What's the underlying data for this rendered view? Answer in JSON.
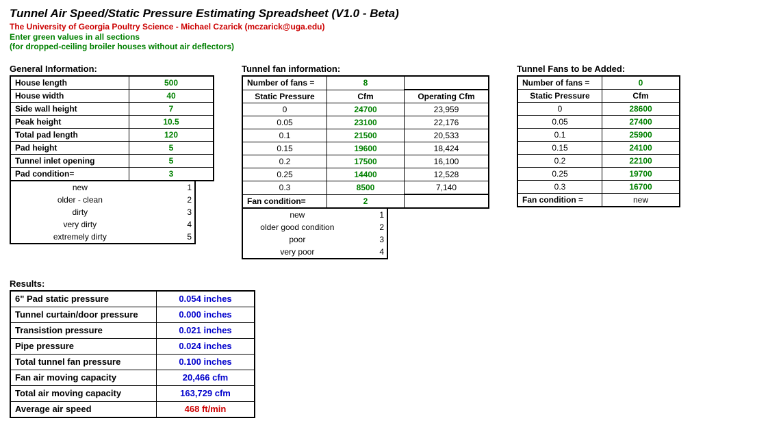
{
  "header": {
    "title": "Tunnel Air Speed/Static Pressure Estimating Spreadsheet  (V1.0 - Beta)",
    "sub_red": "The University of Georgia Poultry Science - Michael Czarick  (mczarick@uga.edu)",
    "sub_green1": "Enter green values in all sections",
    "sub_green2": "(for dropped-ceiling broiler houses without air deflectors)"
  },
  "general": {
    "heading": "General Information:",
    "rows": [
      {
        "label": "House length",
        "value": "500"
      },
      {
        "label": "House width",
        "value": "40"
      },
      {
        "label": "Side wall height",
        "value": "7"
      },
      {
        "label": "Peak height",
        "value": "10.5"
      },
      {
        "label": "Total pad length",
        "value": "120"
      },
      {
        "label": "Pad height",
        "value": "5"
      },
      {
        "label": "Tunnel inlet opening",
        "value": "5"
      },
      {
        "label": "Pad condition=",
        "value": "3"
      }
    ],
    "cond": [
      {
        "label": "new",
        "num": "1"
      },
      {
        "label": "older - clean",
        "num": "2"
      },
      {
        "label": "dirty",
        "num": "3"
      },
      {
        "label": "very dirty",
        "num": "4"
      },
      {
        "label": "extremely dirty",
        "num": "5"
      }
    ]
  },
  "fan": {
    "heading": "Tunnel fan information:",
    "num_label": "Number of fans =",
    "num_value": "8",
    "hdr_sp": "Static Pressure",
    "hdr_cfm": "Cfm",
    "hdr_op": "Operating Cfm",
    "rows": [
      {
        "sp": "0",
        "cfm": "24700",
        "op": "23,959"
      },
      {
        "sp": "0.05",
        "cfm": "23100",
        "op": "22,176"
      },
      {
        "sp": "0.1",
        "cfm": "21500",
        "op": "20,533"
      },
      {
        "sp": "0.15",
        "cfm": "19600",
        "op": "18,424"
      },
      {
        "sp": "0.2",
        "cfm": "17500",
        "op": "16,100"
      },
      {
        "sp": "0.25",
        "cfm": "14400",
        "op": "12,528"
      },
      {
        "sp": "0.3",
        "cfm": "8500",
        "op": "7,140"
      }
    ],
    "cond_label": "Fan condition=",
    "cond_value": "2",
    "cond": [
      {
        "label": "new",
        "num": "1"
      },
      {
        "label": "older good condition",
        "num": "2"
      },
      {
        "label": "poor",
        "num": "3"
      },
      {
        "label": "very poor",
        "num": "4"
      }
    ]
  },
  "add": {
    "heading": "Tunnel Fans to be Added:",
    "num_label": "Number of fans =",
    "num_value": "0",
    "hdr_sp": "Static Pressure",
    "hdr_cfm": "Cfm",
    "rows": [
      {
        "sp": "0",
        "cfm": "28600"
      },
      {
        "sp": "0.05",
        "cfm": "27400"
      },
      {
        "sp": "0.1",
        "cfm": "25900"
      },
      {
        "sp": "0.15",
        "cfm": "24100"
      },
      {
        "sp": "0.2",
        "cfm": "22100"
      },
      {
        "sp": "0.25",
        "cfm": "19700"
      },
      {
        "sp": "0.3",
        "cfm": "16700"
      }
    ],
    "cond_label": "Fan condition =",
    "cond_value": "new"
  },
  "results": {
    "heading": "Results:",
    "rows": [
      {
        "label": "6\" Pad static pressure",
        "value": "0.054 inches",
        "cls": "val-blue"
      },
      {
        "label": "Tunnel curtain/door pressure",
        "value": "0.000 inches",
        "cls": "val-blue"
      },
      {
        "label": "Transistion pressure",
        "value": "0.021 inches",
        "cls": "val-blue"
      },
      {
        "label": "Pipe pressure",
        "value": "0.024 inches",
        "cls": "val-blue"
      },
      {
        "label": "Total tunnel fan pressure",
        "value": "0.100 inches",
        "cls": "val-blue"
      },
      {
        "label": "Fan air moving capacity",
        "value": "20,466 cfm",
        "cls": "val-blue"
      },
      {
        "label": "Total air moving capacity",
        "value": "163,729 cfm",
        "cls": "val-blue"
      },
      {
        "label": "Average air speed",
        "value": "468 ft/min",
        "cls": "val-red"
      }
    ]
  }
}
